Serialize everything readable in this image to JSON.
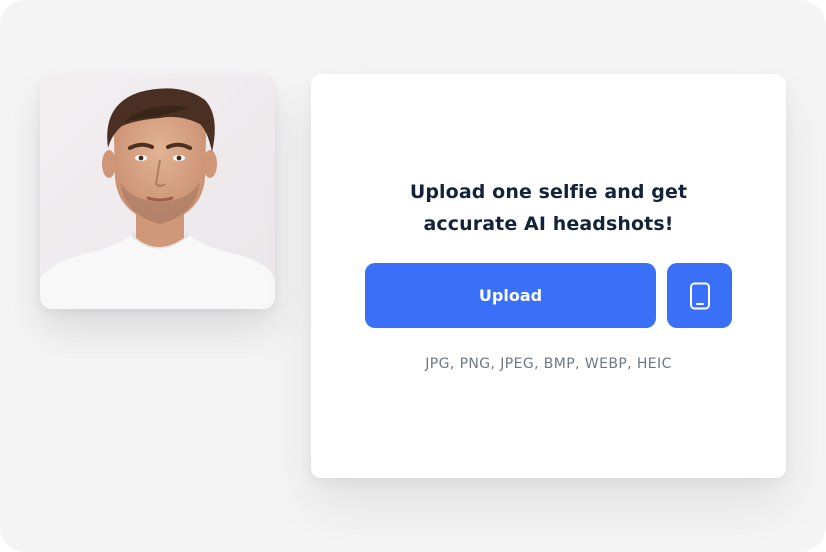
{
  "upload_card": {
    "headline_line1": "Upload one selfie and get",
    "headline_line2": "accurate AI headshots!",
    "upload_label": "Upload",
    "formats_text": "JPG, PNG, JPEG, BMP, WEBP, HEIC"
  },
  "icons": {
    "phone_button_icon": "smartphone-icon"
  },
  "colors": {
    "accent": "#3a6ff8",
    "headline": "#13233b",
    "muted_text": "#707783",
    "background": "#f4f4f5",
    "card": "#ffffff"
  }
}
